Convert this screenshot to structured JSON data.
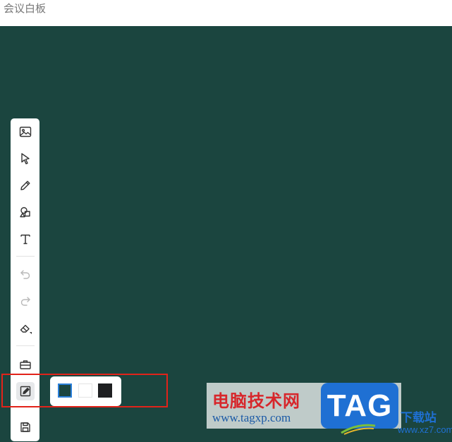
{
  "window": {
    "title": "会议白板"
  },
  "toolbar": {
    "tools": [
      {
        "name": "image-icon"
      },
      {
        "name": "select-pointer-icon"
      },
      {
        "name": "pen-icon"
      },
      {
        "name": "shapes-icon"
      },
      {
        "name": "text-icon"
      },
      {
        "name": "undo-icon"
      },
      {
        "name": "redo-icon"
      },
      {
        "name": "eraser-icon"
      },
      {
        "name": "toolbox-icon"
      },
      {
        "name": "background-edit-icon",
        "active": true
      },
      {
        "name": "save-icon"
      }
    ]
  },
  "background_colors": {
    "options": [
      "#1b453f",
      "#ffffff",
      "#1e1f21"
    ],
    "selected": "#1b453f"
  },
  "watermark": {
    "site_name": "电脑技术网",
    "site_url": "www.tagxp.com",
    "badge": "TAG",
    "secondary_name": "下载站",
    "secondary_url": "www.xz7.com"
  },
  "colors": {
    "board": "#1b453f",
    "highlight": "#e2231a"
  }
}
